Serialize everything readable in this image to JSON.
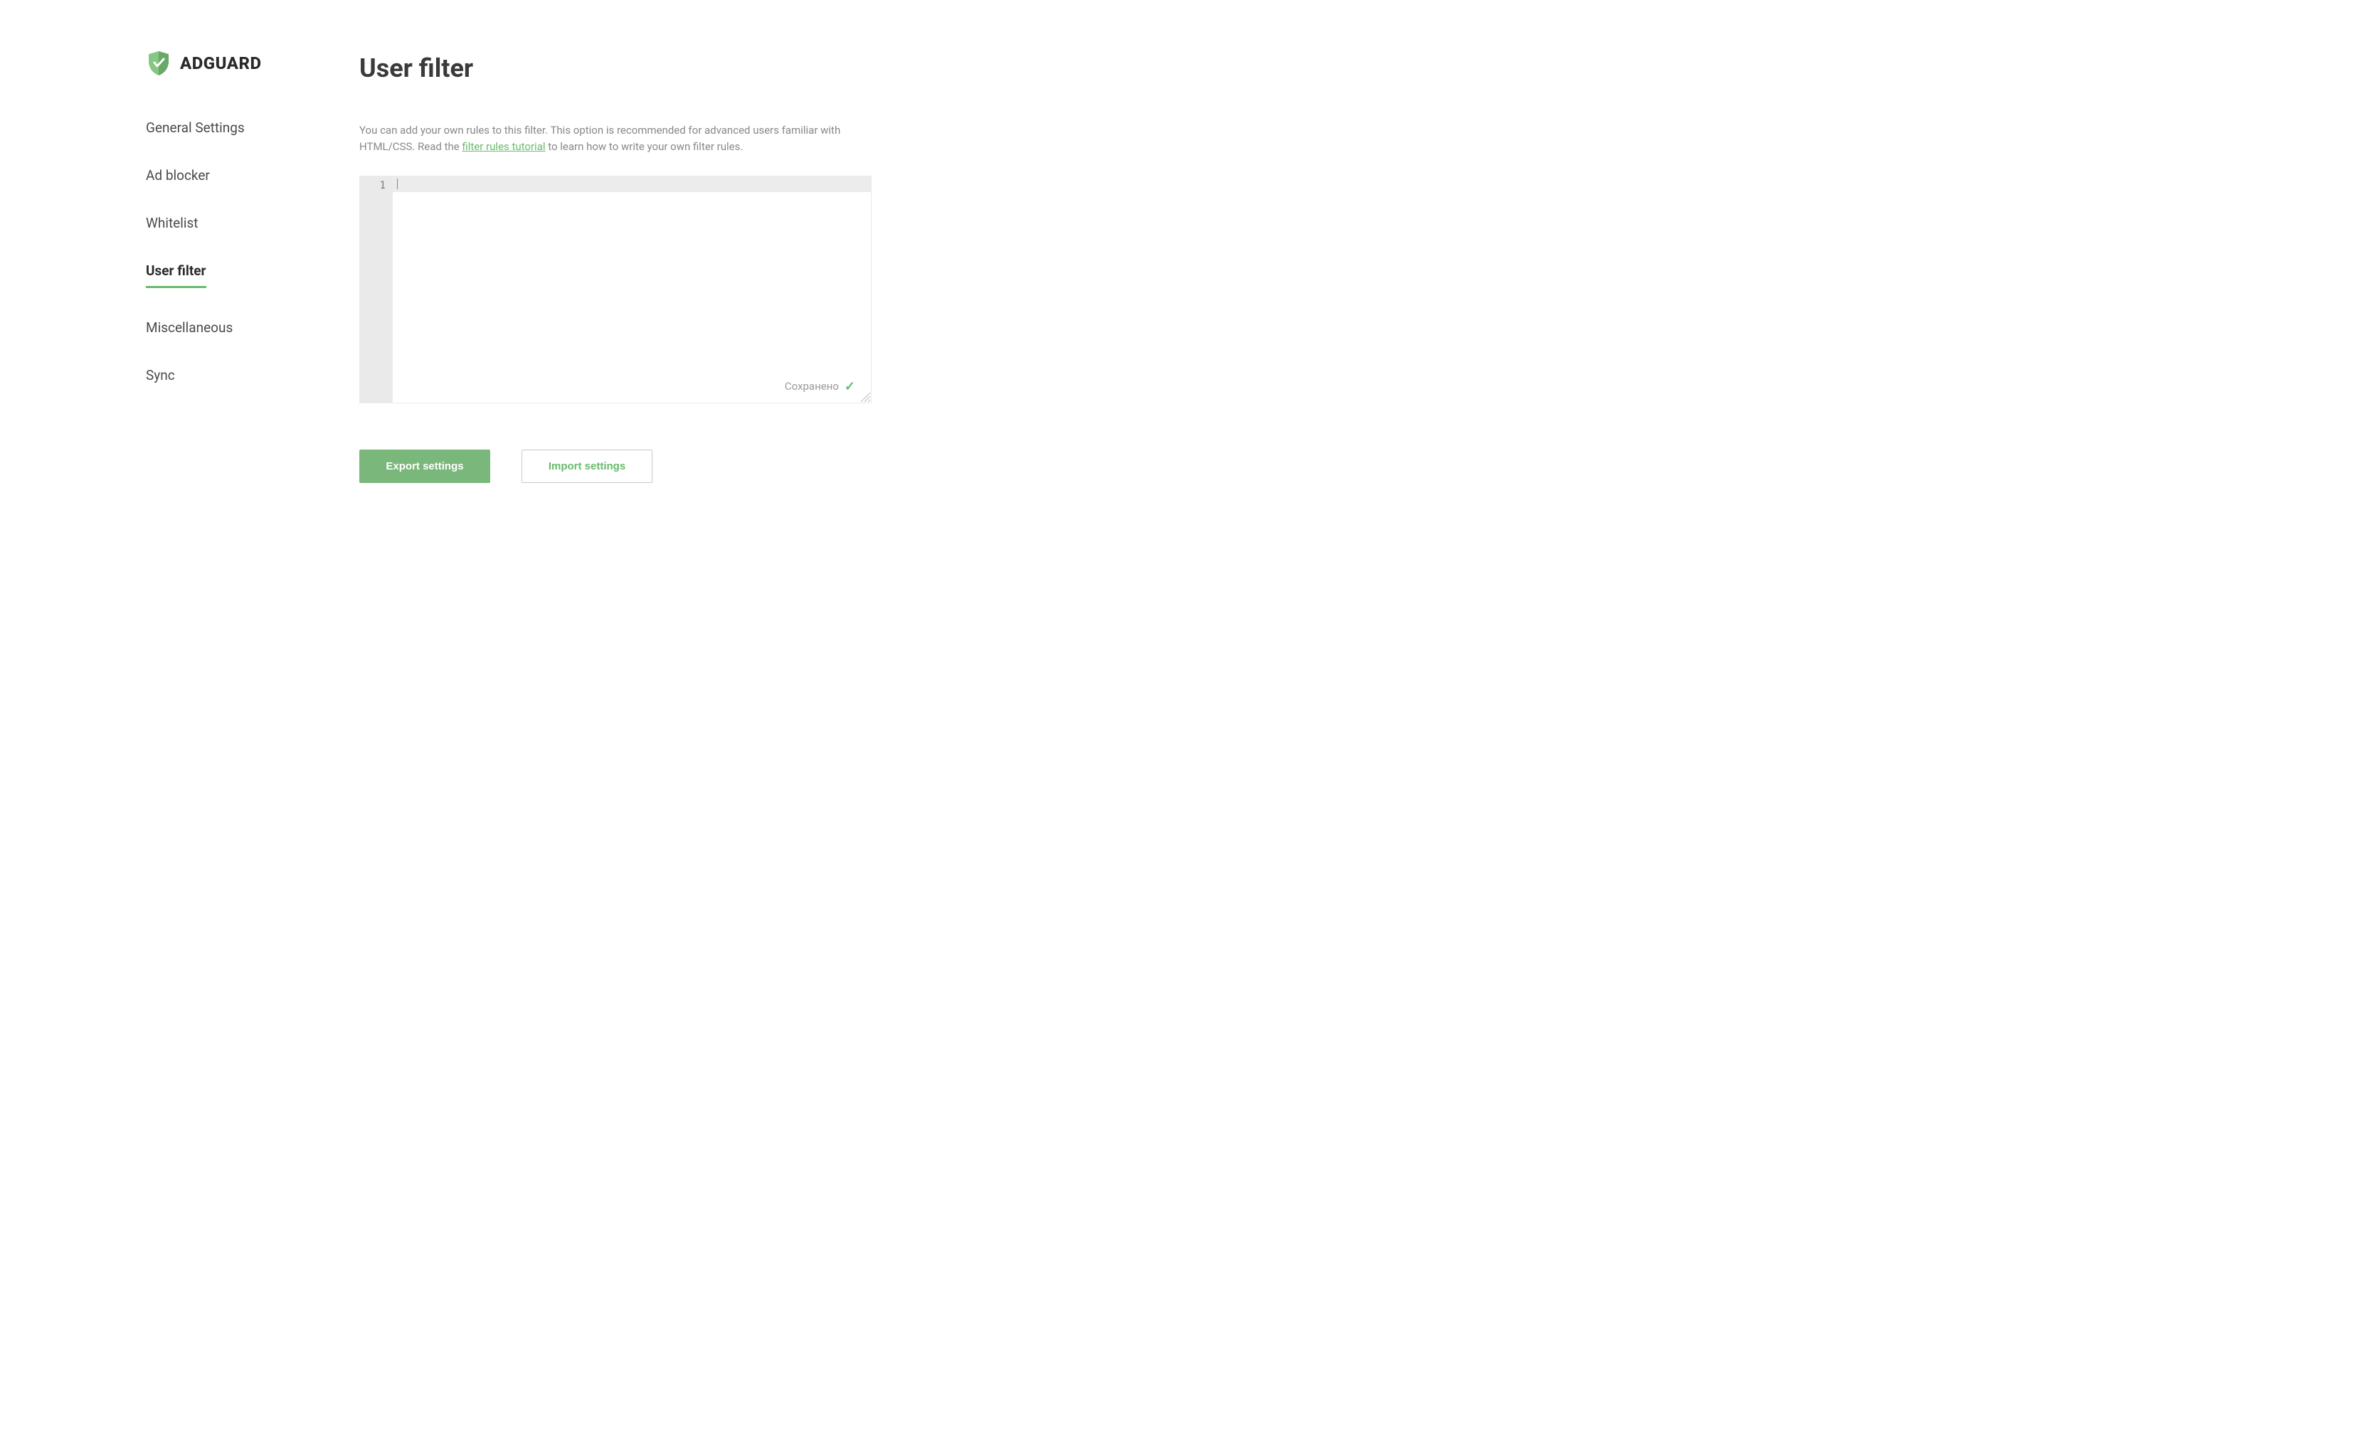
{
  "brand": {
    "name": "ADGUARD"
  },
  "sidebar": {
    "items": [
      {
        "label": "General Settings"
      },
      {
        "label": "Ad blocker"
      },
      {
        "label": "Whitelist"
      },
      {
        "label": "User filter"
      },
      {
        "label": "Miscellaneous"
      },
      {
        "label": "Sync"
      }
    ],
    "active_index": 3
  },
  "page": {
    "title": "User filter",
    "description_pre": "You can add your own rules to this filter. This option is recommended for advanced users familiar with HTML/CSS. Read the ",
    "description_link": "filter rules tutorial",
    "description_post": " to learn how to write your own filter rules."
  },
  "editor": {
    "line_number": "1",
    "content": "",
    "saved_label": "Сохранено"
  },
  "buttons": {
    "export": "Export settings",
    "import": "Import settings"
  }
}
